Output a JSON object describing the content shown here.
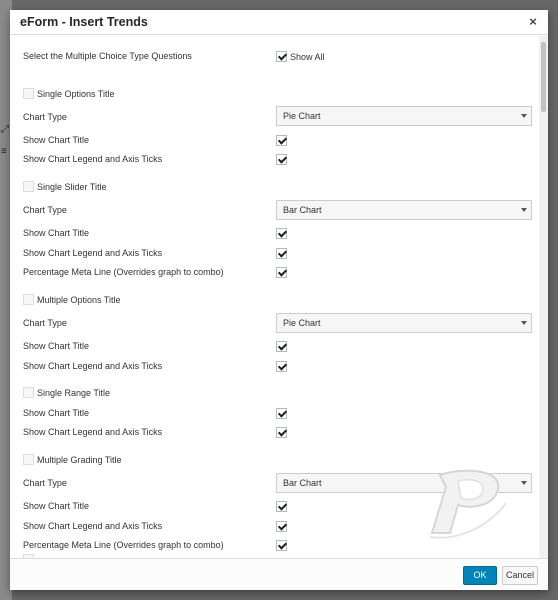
{
  "dialog": {
    "title": "eForm - Insert Trends",
    "close_symbol": "×"
  },
  "background_glyphs": [
    "⤢",
    "≡"
  ],
  "header_row": {
    "label": "Select the Multiple Choice Type Questions",
    "show_all_label": "Show All",
    "show_all_checked": true
  },
  "sections": [
    {
      "title": "Single Options Title",
      "chart_type_label": "Chart Type",
      "chart_type_value": "Pie Chart",
      "show_title_label": "Show Chart Title",
      "legend_label": "Show Chart Legend and Axis Ticks"
    },
    {
      "title": "Single Slider Title",
      "chart_type_label": "Chart Type",
      "chart_type_value": "Bar Chart",
      "show_title_label": "Show Chart Title",
      "legend_label": "Show Chart Legend and Axis Ticks",
      "meta_label": "Percentage Meta Line (Overrides graph to combo)"
    },
    {
      "title": "Multiple Options Title",
      "chart_type_label": "Chart Type",
      "chart_type_value": "Pie Chart",
      "show_title_label": "Show Chart Title",
      "legend_label": "Show Chart Legend and Axis Ticks"
    },
    {
      "title": "Single Range Title",
      "show_title_label": "Show Chart Title",
      "legend_label": "Show Chart Legend and Axis Ticks"
    },
    {
      "title": "Multiple Grading Title",
      "chart_type_label": "Chart Type",
      "chart_type_value": "Bar Chart",
      "show_title_label": "Show Chart Title",
      "legend_label": "Show Chart Legend and Axis Ticks",
      "meta_label": "Percentage Meta Line (Overrides graph to combo)"
    }
  ],
  "footer": {
    "ok_label": "OK",
    "cancel_label": "Cancel"
  },
  "colors": {
    "primary_button": "#0085ba",
    "overlay": "#676767"
  }
}
